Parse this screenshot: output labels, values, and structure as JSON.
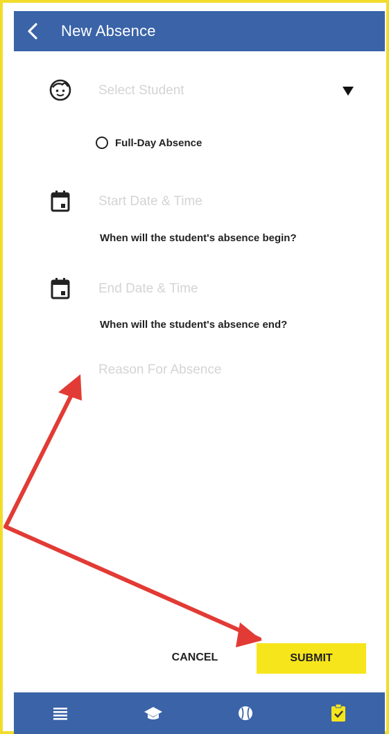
{
  "appbar": {
    "title": "New Absence",
    "back_icon": "chevron-left-icon"
  },
  "form": {
    "student": {
      "placeholder": "Select Student",
      "icon": "child-face-icon"
    },
    "full_day": {
      "label": "Full-Day Absence",
      "checked": false
    },
    "start": {
      "placeholder": "Start Date & Time",
      "helper": "When will the student's absence begin?",
      "icon": "calendar-icon"
    },
    "end": {
      "placeholder": "End Date & Time",
      "helper": "When will the student's absence end?",
      "icon": "calendar-icon"
    },
    "reason": {
      "placeholder": "Reason For Absence"
    }
  },
  "actions": {
    "cancel": "CANCEL",
    "submit": "SUBMIT"
  },
  "bottom_nav": {
    "items": [
      {
        "icon": "list-icon"
      },
      {
        "icon": "graduation-cap-icon"
      },
      {
        "icon": "baseball-icon"
      },
      {
        "icon": "clipboard-check-icon",
        "active": true
      }
    ]
  },
  "colors": {
    "primary": "#3a63a8",
    "accent": "#f7e51c",
    "frame_border": "#f2dc2b",
    "annotation_arrow": "#e23b35"
  }
}
